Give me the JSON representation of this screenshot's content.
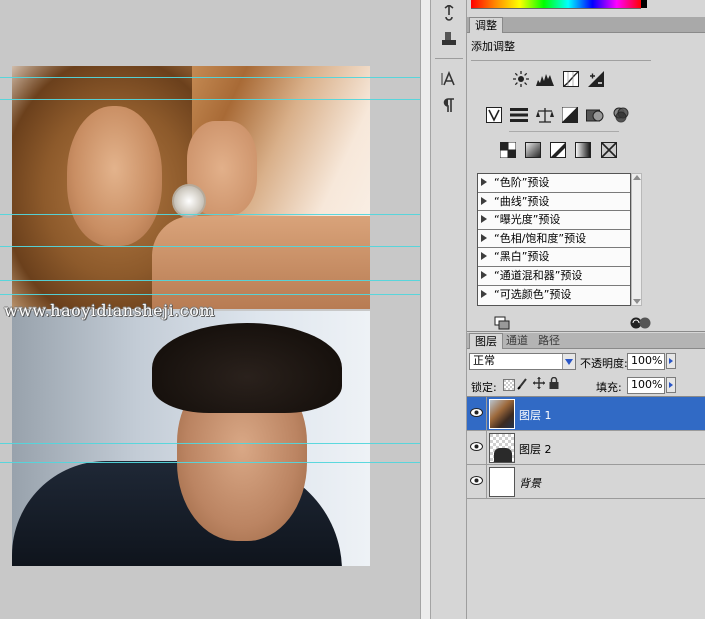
{
  "document": {
    "watermark": "www.haoyidiansheji.com"
  },
  "tools": {
    "icons": [
      "adjust-pin-icon",
      "clone-source-icon",
      "character-icon",
      "paragraph-icon"
    ]
  },
  "adjustments": {
    "tab_label": "调整",
    "subtitle": "添加调整",
    "presets": [
      "“色阶”预设",
      "“曲线”预设",
      "“曝光度”预设",
      "“色相/饱和度”预设",
      "“黑白”预设",
      "“通道混和器”预设",
      "“可选颜色”预设"
    ]
  },
  "layers": {
    "tabs": [
      "图层",
      "通道",
      "路径"
    ],
    "blend_mode": "正常",
    "opacity_label": "不透明度:",
    "opacity_value": "100%",
    "lock_label": "锁定:",
    "fill_label": "填充:",
    "fill_value": "100%",
    "items": [
      {
        "name": "图层 1"
      },
      {
        "name": "图层 2"
      },
      {
        "name": "背景"
      }
    ]
  },
  "colors": {
    "selection": "#316ac5",
    "guide": "#53d6dc",
    "panel": "#d6d6d6"
  }
}
